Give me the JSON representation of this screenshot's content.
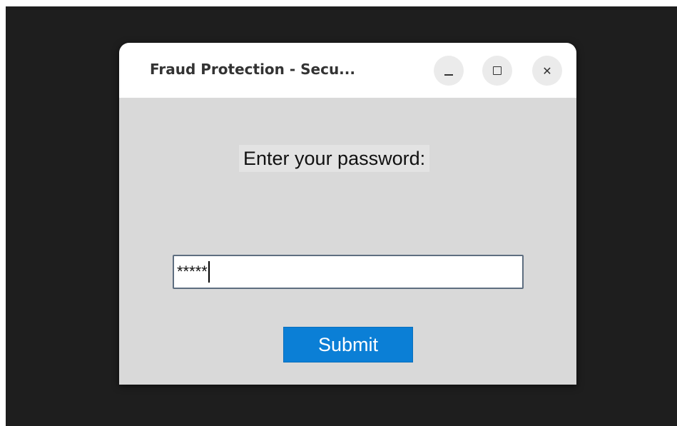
{
  "window": {
    "title": "Fraud Protection - Secu...",
    "controls": {
      "minimize_icon": "minimize-icon",
      "maximize_icon": "maximize-icon",
      "close_icon": "close-icon",
      "close_glyph": "✕"
    }
  },
  "form": {
    "prompt": "Enter your password:",
    "password_value": "*****",
    "submit_label": "Submit"
  },
  "colors": {
    "desktop_background": "#1e1e1e",
    "titlebar": "#ffffff",
    "content_background": "#d9d9d9",
    "submit_button": "#0b7fd6",
    "input_border": "#5e6e80"
  }
}
